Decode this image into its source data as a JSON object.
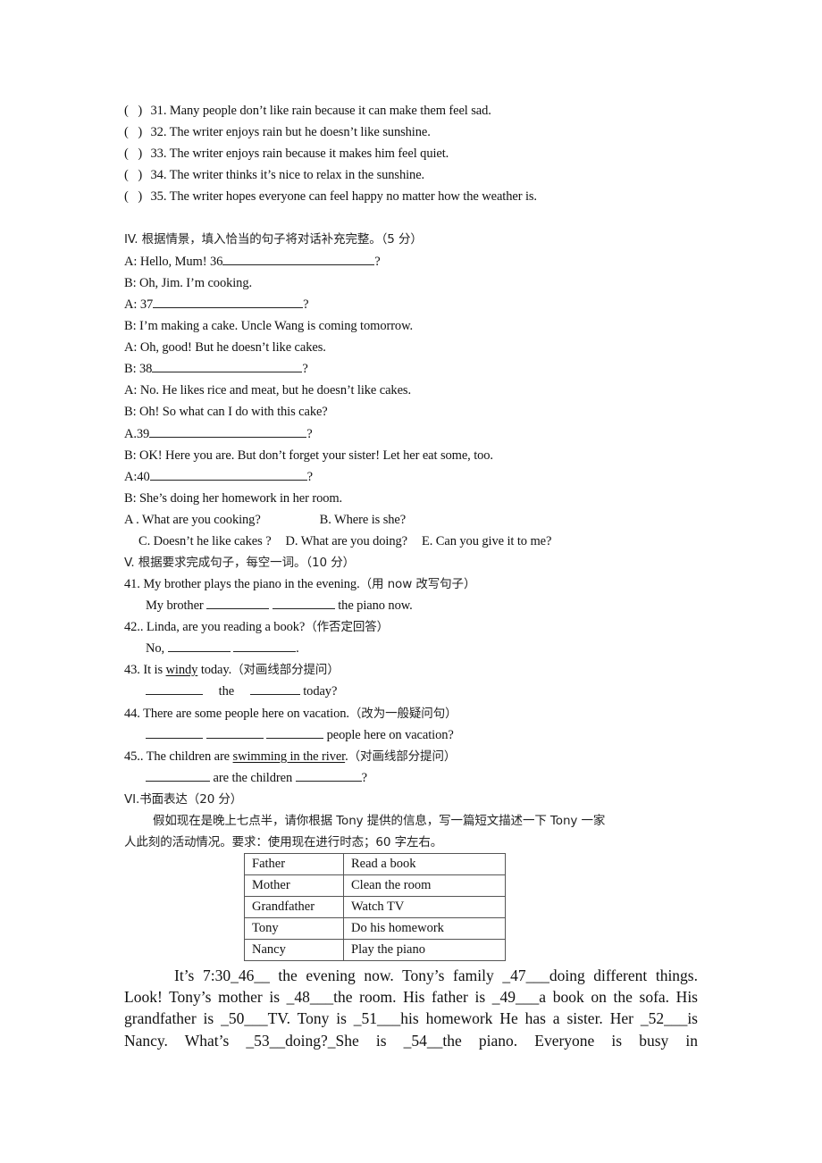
{
  "section3": {
    "items": [
      {
        "paren_open": "(",
        "paren_close": ")",
        "text": "31. Many people don’t like rain because it can make them feel sad."
      },
      {
        "paren_open": "(",
        "paren_close": ")",
        "text": "32. The writer enjoys rain but he doesn’t like sunshine."
      },
      {
        "paren_open": "(",
        "paren_close": ")",
        "text": "33. The writer enjoys rain because it makes him feel quiet."
      },
      {
        "paren_open": "(",
        "paren_close": ")",
        "text": "34. The writer thinks it’s nice to relax in the sunshine."
      },
      {
        "paren_open": "(",
        "paren_close": ")",
        "text": "35. The writer hopes everyone can feel happy no matter how the weather is."
      }
    ]
  },
  "section4": {
    "heading": "IV. 根据情景，填入恰当的句子将对话补充完整。（5 分）",
    "dialogue": [
      {
        "prefix": "A: Hello, Mum! 36",
        "suffix": "?",
        "has_blank": true
      },
      {
        "prefix": "B: Oh, Jim. I’m cooking.",
        "suffix": "",
        "has_blank": false
      },
      {
        "prefix": "A: 37",
        "suffix": "?",
        "has_blank": true
      },
      {
        "prefix": "B: I’m making a cake. Uncle Wang is coming tomorrow.",
        "suffix": "",
        "has_blank": false
      },
      {
        "prefix": "A: Oh, good! But he doesn’t like cakes.",
        "suffix": "",
        "has_blank": false
      },
      {
        "prefix": "B: 38",
        "suffix": "?",
        "has_blank": true
      },
      {
        "prefix": "A: No. He likes rice and meat, but he doesn’t like cakes.",
        "suffix": "",
        "has_blank": false
      },
      {
        "prefix": "B: Oh! So what can I do with this cake?",
        "suffix": "",
        "has_blank": false
      },
      {
        "prefix": "A.39",
        "suffix": "?",
        "has_blank": true
      },
      {
        "prefix": "B: OK! Here you are. But don’t forget your sister! Let her eat some, too.",
        "suffix": "",
        "has_blank": false
      },
      {
        "prefix": "A:40",
        "suffix": "?",
        "has_blank": true
      },
      {
        "prefix": "B: She’s doing her homework in her room.",
        "suffix": "",
        "has_blank": false
      }
    ],
    "options": {
      "A": "A . What are you cooking?",
      "B": "B. Where is she?",
      "C": "C. Doesn’t he like cakes ?",
      "D": "D. What are you doing?",
      "E": "E. Can you give it to me?"
    }
  },
  "section5": {
    "heading": "V. 根据要求完成句子，每空一词。（10 分）",
    "q41": {
      "text": "41. My brother plays the piano in the evening.",
      "instruction": "（用 now 改写句子）",
      "answer_prefix": "My brother",
      "answer_suffix": "the piano now."
    },
    "q42": {
      "text": "42.. Linda, are you reading a book?",
      "instruction": "（作否定回答）",
      "answer_prefix": "No,",
      "answer_suffix": "."
    },
    "q43": {
      "text_before": "43. It is ",
      "underlined": "windy",
      "text_after": " today.",
      "instruction": "（对画线部分提问）",
      "answer_mid": "the",
      "answer_suffix": "today?"
    },
    "q44": {
      "text": "44. There are some people here on vacation.",
      "instruction": "（改为一般疑问句）",
      "answer_suffix": "people here on vacation?"
    },
    "q45": {
      "text_before": "45.. The children are ",
      "underlined": "swimming in the river",
      "text_after": ".",
      "instruction": "（对画线部分提问）",
      "answer_mid": "are the children",
      "answer_suffix": "?"
    }
  },
  "section6": {
    "heading": "VI.书面表达（20 分）",
    "prompt_line1": "假如现在是晚上七点半，请你根据 Tony 提供的信息，写一篇短文描述一下 Tony 一家",
    "prompt_line2": "人此刻的活动情况。要求：使用现在进行时态；60 字左右。",
    "table": [
      {
        "person": "Father",
        "activity": "Read a book"
      },
      {
        "person": "Mother",
        "activity": "Clean the room"
      },
      {
        "person": "Grandfather",
        "activity": "Watch TV"
      },
      {
        "person": "Tony",
        "activity": "Do his homework"
      },
      {
        "person": "Nancy",
        "activity": "Play the piano"
      }
    ],
    "passage": [
      "It’s 7:30_46__ the evening now. Tony’s family _47___doing different things.",
      "Look! Tony’s mother is _48___the room. His father is _49___a book on the sofa. His",
      "grandfather is _50___TV. Tony is _51___his homework He has a sister. Her _52___is",
      "Nancy. What’s _53__doing?_She is _54__the piano. Everyone is busy in"
    ]
  }
}
